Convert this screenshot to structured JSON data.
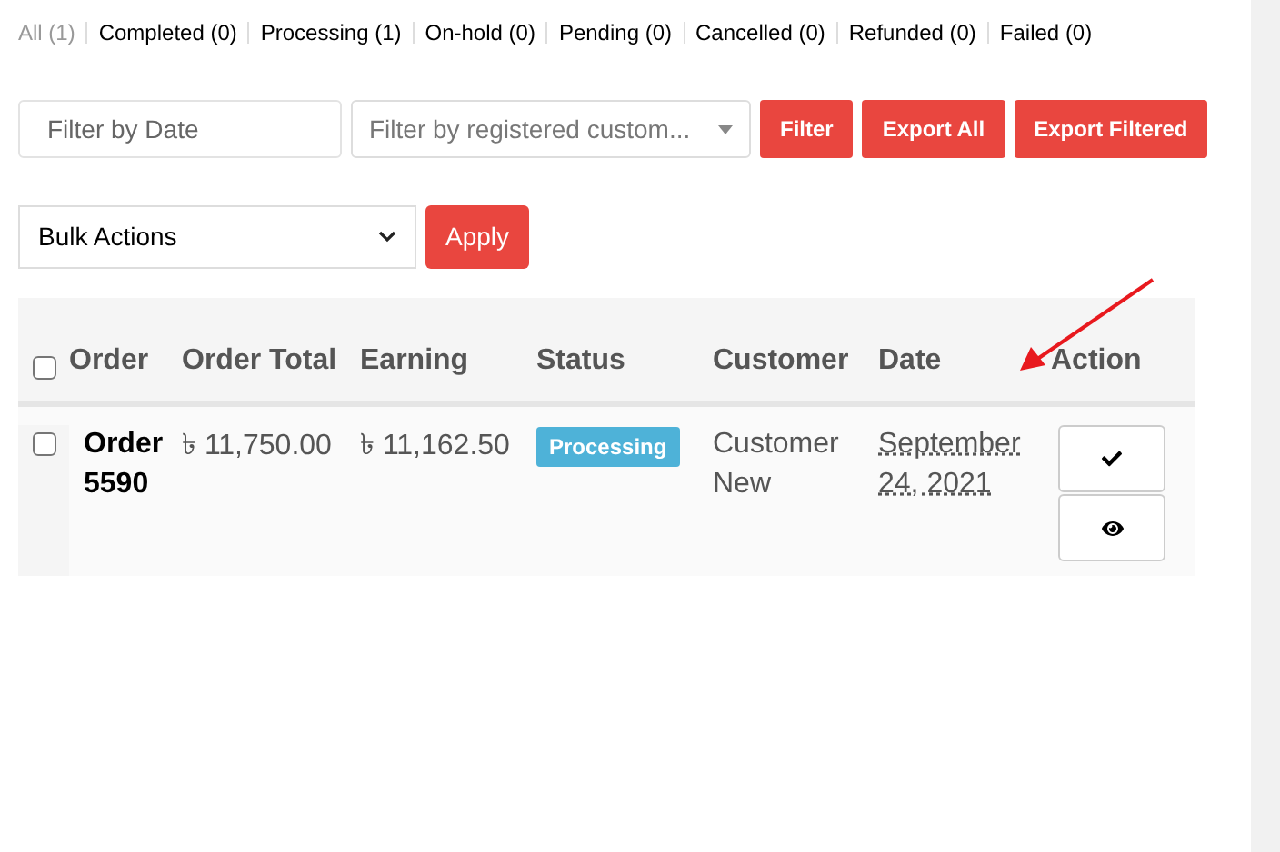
{
  "status_tabs": [
    {
      "label": "All (1)",
      "selected": true
    },
    {
      "label": "Completed (0)",
      "selected": false
    },
    {
      "label": "Processing (1)",
      "selected": false
    },
    {
      "label": "On-hold (0)",
      "selected": false
    },
    {
      "label": "Pending (0)",
      "selected": false
    },
    {
      "label": "Cancelled (0)",
      "selected": false
    },
    {
      "label": "Refunded (0)",
      "selected": false
    },
    {
      "label": "Failed (0)",
      "selected": false
    }
  ],
  "filters": {
    "date": {
      "placeholder": "Filter by Date"
    },
    "customer": {
      "placeholder": "Filter by registered custom..."
    },
    "buttons": [
      "Filter",
      "Export All",
      "Export Filtered"
    ]
  },
  "bulk": {
    "select": "Bulk Actions",
    "button": "Apply"
  },
  "table": {
    "select_all": {
      "checked": false
    },
    "columns": [
      "Order",
      "Order Total",
      "Earning",
      "Status",
      "Customer",
      "Date",
      "Action"
    ],
    "rows": [
      {
        "checked": false,
        "order": "Order 5590",
        "total": "৳ 11,750.00",
        "earning": "৳ 11,162.50",
        "status": "Processing",
        "customer": "Customer New",
        "date": "September 24, 2021"
      }
    ]
  },
  "annotation": {
    "kind": "arrow"
  }
}
